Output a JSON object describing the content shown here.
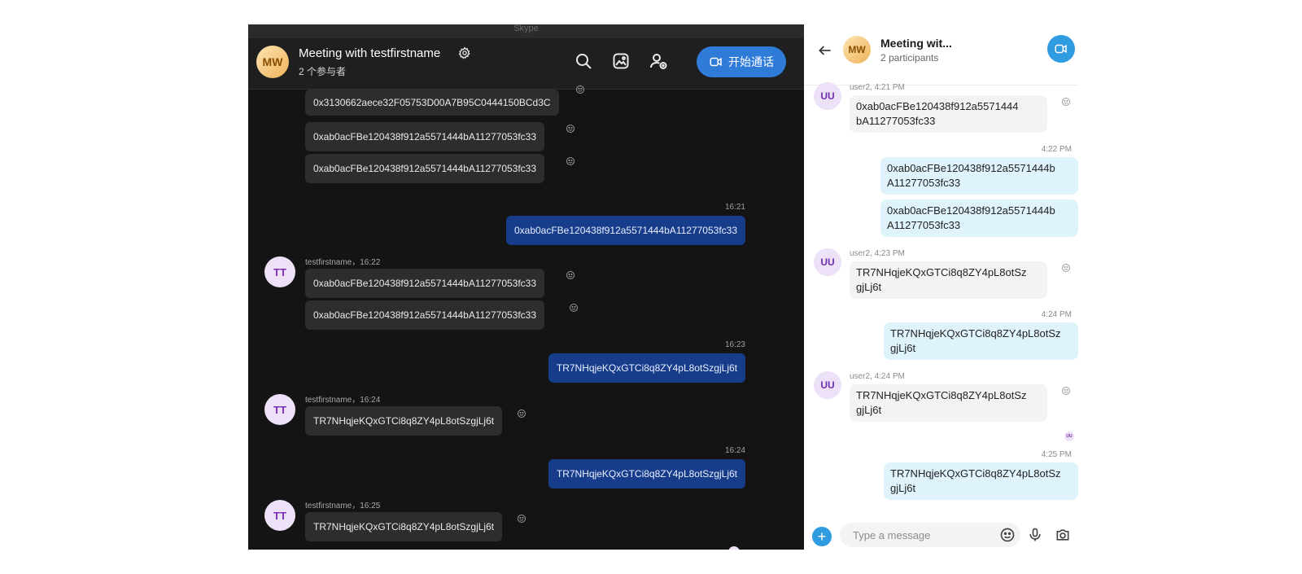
{
  "desktop": {
    "app_title": "Skype",
    "header": {
      "avatar_initials": "MW",
      "title": "Meeting with testfirstname",
      "subtitle": "2 个参与者",
      "call_label": "开始通话"
    },
    "messages": {
      "m1": "0x3130662aece32F05753D00A7B95C0444150BCd3C",
      "m2": "0xab0acFBe120438f912a5571444bA11277053fc33",
      "m3": "0xab0acFBe120438f912a5571444bA11277053fc33",
      "t1": "16:21",
      "o1": "0xab0acFBe120438f912a5571444bA11277053fc33",
      "s1": "testfirstname，16:22",
      "m4": "0xab0acFBe120438f912a5571444bA11277053fc33",
      "m5": "0xab0acFBe120438f912a5571444bA11277053fc33",
      "t2": "16:23",
      "o2": "TR7NHqjeKQxGTCi8q8ZY4pL8otSzgjLj6t",
      "s2": "testfirstname，16:24",
      "m6": "TR7NHqjeKQxGTCi8q8ZY4pL8otSzgjLj6t",
      "t3": "16:24",
      "o3": "TR7NHqjeKQxGTCi8q8ZY4pL8otSzgjLj6t",
      "s3": "testfirstname，16:25",
      "m7": "TR7NHqjeKQxGTCi8q8ZY4pL8otSzgjLj6t",
      "avatar_initials": "TT"
    }
  },
  "mobile": {
    "header": {
      "avatar_initials": "MW",
      "title": "Meeting wit...",
      "subtitle": "2 participants"
    },
    "messages": {
      "s1": "user2, 4:21 PM",
      "m1": "0xab0acFBe120438f912a5571444 bA11277053fc33",
      "t1": "4:22 PM",
      "o1": "0xab0acFBe120438f912a5571444b A11277053fc33",
      "o2": "0xab0acFBe120438f912a5571444b A11277053fc33",
      "s2": "user2, 4:23 PM",
      "m2": "TR7NHqjeKQxGTCi8q8ZY4pL8otSz gjLj6t",
      "t2": "4:24 PM",
      "o3": "TR7NHqjeKQxGTCi8q8ZY4pL8otSz gjLj6t",
      "s3": "user2, 4:24 PM",
      "m3": "TR7NHqjeKQxGTCi8q8ZY4pL8otSz gjLj6t",
      "t3": "4:25 PM",
      "o4": "TR7NHqjeKQxGTCi8q8ZY4pL8otSz gjLj6t",
      "avatar_initials": "UU"
    },
    "compose": {
      "placeholder": "Type a message"
    }
  },
  "icons": {
    "search": "search-icon",
    "gallery": "gallery-icon",
    "add_person": "add-person-icon",
    "video": "video-call-icon",
    "gear": "gear-icon",
    "emoji": "emoji-icon",
    "mic": "microphone-icon",
    "camera": "camera-icon",
    "back": "back-arrow-icon"
  },
  "colors": {
    "accent_blue": "#2f7bd8",
    "outgoing_dark": "#173c8a",
    "outgoing_light": "#dff3fc"
  }
}
